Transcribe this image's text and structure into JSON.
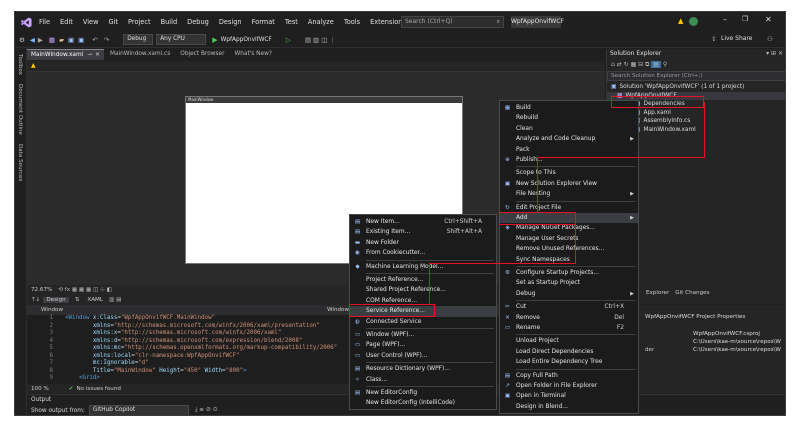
{
  "titlebar": {
    "menu": [
      "File",
      "Edit",
      "View",
      "Git",
      "Project",
      "Build",
      "Debug",
      "Design",
      "Format",
      "Test",
      "Analyze",
      "Tools",
      "Extensions",
      "Window",
      "Help"
    ],
    "search_placeholder": "Search (Ctrl+Q)",
    "solution_name": "WpfAppOnvifWCF",
    "live_share": "Live Share"
  },
  "toolbar": {
    "config": "Debug",
    "platform": "Any CPU",
    "run_target": "WpfAppOnvifWCF"
  },
  "left_strip": [
    "Toolbox",
    "Document Outline",
    "Data Sources"
  ],
  "tabs": [
    {
      "label": "MainWindow.xaml",
      "active": true
    },
    {
      "label": "MainWindow.xaml.cs",
      "active": false
    },
    {
      "label": "Object Browser",
      "active": false
    },
    {
      "label": "What's New?",
      "active": false
    }
  ],
  "designer": {
    "window_title": "MainWindow",
    "zoom": "72.67%",
    "design_tab": "Design",
    "xaml_tab": "XAML",
    "path_left": "Window",
    "path_right": "Window"
  },
  "code": [
    {
      "n": "1",
      "segs": [
        [
          "tag",
          "<Window "
        ],
        [
          "attr",
          "x:Class"
        ],
        [
          "txt",
          "="
        ],
        [
          "str",
          "\"WpfAppOnvifWCF.MainWindow\""
        ]
      ]
    },
    {
      "n": "2",
      "segs": [
        [
          "attr",
          "        xmlns"
        ],
        [
          "txt",
          "="
        ],
        [
          "str",
          "\"http://schemas.microsoft.com/winfx/2006/xaml/presentation\""
        ]
      ]
    },
    {
      "n": "3",
      "segs": [
        [
          "attr",
          "        xmlns:x"
        ],
        [
          "txt",
          "="
        ],
        [
          "str",
          "\"http://schemas.microsoft.com/winfx/2006/xaml\""
        ]
      ]
    },
    {
      "n": "4",
      "segs": [
        [
          "attr",
          "        xmlns:d"
        ],
        [
          "txt",
          "="
        ],
        [
          "str",
          "\"http://schemas.microsoft.com/expression/blend/2008\""
        ]
      ]
    },
    {
      "n": "5",
      "segs": [
        [
          "attr",
          "        xmlns:mc"
        ],
        [
          "txt",
          "="
        ],
        [
          "str",
          "\"http://schemas.openxmlformats.org/markup-compatibility/2006\""
        ]
      ]
    },
    {
      "n": "6",
      "segs": [
        [
          "attr",
          "        xmlns:local"
        ],
        [
          "txt",
          "="
        ],
        [
          "str",
          "\"clr-namespace:WpfAppOnvifWCF\""
        ]
      ]
    },
    {
      "n": "7",
      "segs": [
        [
          "attr",
          "        mc:Ignorable"
        ],
        [
          "txt",
          "="
        ],
        [
          "str",
          "\"d\""
        ]
      ]
    },
    {
      "n": "8",
      "segs": [
        [
          "attr",
          "        Title"
        ],
        [
          "txt",
          "="
        ],
        [
          "str",
          "\"MainWindow\""
        ],
        [
          "attr",
          " Height"
        ],
        [
          "txt",
          "="
        ],
        [
          "str",
          "\"450\""
        ],
        [
          "attr",
          " Width"
        ],
        [
          "txt",
          "="
        ],
        [
          "str",
          "\"800\""
        ],
        [
          "tag",
          ">"
        ]
      ]
    },
    {
      "n": "9",
      "segs": [
        [
          "tag",
          "    <Grid>"
        ]
      ]
    }
  ],
  "status": {
    "zoom": "100 %",
    "issues": "No issues found"
  },
  "output": {
    "title": "Output",
    "show_from": "Show output from:",
    "source": "GitHub Copilot"
  },
  "solution_explorer": {
    "title": "Solution Explorer",
    "search_placeholder": "Search Solution Explorer (Ctrl+;)",
    "items": [
      "Solution 'WpfAppOnvifWCF' (1 of 1 project)",
      "WpfAppOnvifWCF",
      "Dependencies",
      "App.xaml",
      "AssemblyInfo.cs",
      "MainWindow.xaml"
    ],
    "bottom_tabs": [
      "Explorer",
      "Git Changes"
    ]
  },
  "properties": {
    "header": "WpfAppOnvifWCF Project Properties",
    "rows": [
      {
        "label": "",
        "value": "WpfAppOnvifWCF.csproj"
      },
      {
        "label": "",
        "value": "C:\\Users\\kae-m\\source\\repos\\W"
      },
      {
        "label": "der",
        "value": "C:\\Users\\kae-m\\source\\repos\\W"
      }
    ]
  },
  "project_menu": [
    {
      "label": "Build",
      "icon": "▦"
    },
    {
      "label": "Rebuild"
    },
    {
      "label": "Clean"
    },
    {
      "label": "Analyze and Code Cleanup",
      "arrow": true
    },
    {
      "label": "Pack"
    },
    {
      "label": "Publish...",
      "icon": "⊕"
    },
    {
      "sep": true
    },
    {
      "label": "Scope to This"
    },
    {
      "label": "New Solution Explorer View",
      "icon": "▣"
    },
    {
      "label": "File Nesting",
      "arrow": true
    },
    {
      "sep": true
    },
    {
      "label": "Edit Project File",
      "icon": "↻"
    },
    {
      "label": "Add",
      "arrow": true,
      "highlight": true
    },
    {
      "label": "Manage NuGet Packages...",
      "icon": "◈"
    },
    {
      "label": "Manage User Secrets"
    },
    {
      "label": "Remove Unused References..."
    },
    {
      "label": "Sync Namespaces"
    },
    {
      "sep": true
    },
    {
      "label": "Configure Startup Projects...",
      "icon": "⚙"
    },
    {
      "label": "Set as Startup Project"
    },
    {
      "label": "Debug",
      "arrow": true
    },
    {
      "sep": true
    },
    {
      "label": "Cut",
      "icon": "✂",
      "shortcut": "Ctrl+X"
    },
    {
      "label": "Remove",
      "icon": "✕",
      "shortcut": "Del"
    },
    {
      "label": "Rename",
      "icon": "▭",
      "shortcut": "F2"
    },
    {
      "sep": true
    },
    {
      "label": "Unload Project"
    },
    {
      "label": "Load Direct Dependencies"
    },
    {
      "label": "Load Entire Dependency Tree"
    },
    {
      "sep": true
    },
    {
      "label": "Copy Full Path",
      "icon": "▤"
    },
    {
      "label": "Open Folder in File Explorer",
      "icon": "↗"
    },
    {
      "label": "Open in Terminal",
      "icon": "▣"
    },
    {
      "label": "Design in Blend..."
    }
  ],
  "add_menu": [
    {
      "label": "New Item...",
      "icon": "▤",
      "shortcut": "Ctrl+Shift+A"
    },
    {
      "label": "Existing Item...",
      "icon": "▤",
      "shortcut": "Shift+Alt+A"
    },
    {
      "label": "New Folder",
      "icon": "▬"
    },
    {
      "label": "From Cookiecutter...",
      "icon": "◉"
    },
    {
      "sep": true
    },
    {
      "label": "Machine Learning Model...",
      "icon": "◆"
    },
    {
      "sep": true
    },
    {
      "label": "Project Reference..."
    },
    {
      "label": "Shared Project Reference..."
    },
    {
      "label": "COM Reference..."
    },
    {
      "label": "Service Reference...",
      "highlight": true
    },
    {
      "label": "Connected Service",
      "icon": "◍"
    },
    {
      "sep": true
    },
    {
      "label": "Window (WPF)...",
      "icon": "▭"
    },
    {
      "label": "Page (WPF)...",
      "icon": "▭"
    },
    {
      "label": "User Control (WPF)...",
      "icon": "▭"
    },
    {
      "sep": true
    },
    {
      "label": "Resource Dictionary (WPF)...",
      "icon": "▤"
    },
    {
      "label": "Class...",
      "icon": "✧"
    },
    {
      "sep": true
    },
    {
      "label": "New EditorConfig",
      "icon": "▤"
    },
    {
      "label": "New EditorConfig (IntelliCode)"
    }
  ],
  "colors": {
    "accent_red": "#e81123",
    "vs_purple": "#68217a",
    "bg_dark": "#1f1f1f"
  }
}
